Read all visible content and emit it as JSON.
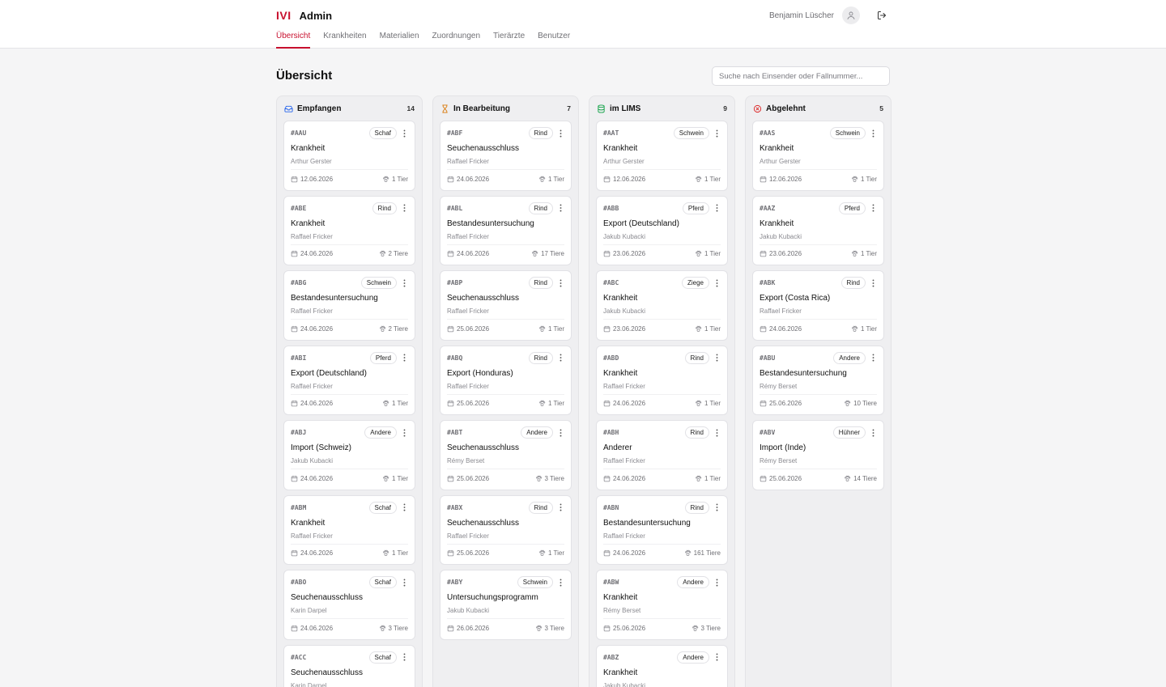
{
  "app": {
    "logo": "IVI",
    "title": "Admin"
  },
  "user": {
    "name": "Benjamin Lüscher"
  },
  "nav": [
    {
      "label": "Übersicht",
      "active": true
    },
    {
      "label": "Krankheiten",
      "active": false
    },
    {
      "label": "Materialien",
      "active": false
    },
    {
      "label": "Zuordnungen",
      "active": false
    },
    {
      "label": "Tierärzte",
      "active": false
    },
    {
      "label": "Benutzer",
      "active": false
    }
  ],
  "page": {
    "title": "Übersicht",
    "search_placeholder": "Suche nach Einsender oder Fallnummer..."
  },
  "colors": {
    "brand": "#c8102e",
    "received": "#2563eb",
    "in_progress": "#d97706",
    "lims": "#16a34a",
    "rejected": "#dc2626"
  },
  "columns": [
    {
      "title": "Empfangen",
      "count": "14",
      "icon": "inbox-icon",
      "cards": [
        {
          "id": "#AAU",
          "species": "Schaf",
          "title": "Krankheit",
          "sender": "Arthur Gerster",
          "date": "12.06.2026",
          "animals": "1 Tier"
        },
        {
          "id": "#ABE",
          "species": "Rind",
          "title": "Krankheit",
          "sender": "Raffael Fricker",
          "date": "24.06.2026",
          "animals": "2 Tiere"
        },
        {
          "id": "#ABG",
          "species": "Schwein",
          "title": "Bestandesuntersuchung",
          "sender": "Raffael Fricker",
          "date": "24.06.2026",
          "animals": "2 Tiere"
        },
        {
          "id": "#ABI",
          "species": "Pferd",
          "title": "Export (Deutschland)",
          "sender": "Raffael Fricker",
          "date": "24.06.2026",
          "animals": "1 Tier"
        },
        {
          "id": "#ABJ",
          "species": "Andere",
          "title": "Import (Schweiz)",
          "sender": "Jakub Kubacki",
          "date": "24.06.2026",
          "animals": "1 Tier"
        },
        {
          "id": "#ABM",
          "species": "Schaf",
          "title": "Krankheit",
          "sender": "Raffael Fricker",
          "date": "24.06.2026",
          "animals": "1 Tier"
        },
        {
          "id": "#ABO",
          "species": "Schaf",
          "title": "Seuchenausschluss",
          "sender": "Karin Darpel",
          "date": "24.06.2026",
          "animals": "3 Tiere"
        },
        {
          "id": "#ACC",
          "species": "Schaf",
          "title": "Seuchenausschluss",
          "sender": "Karin Darpel",
          "date": "",
          "animals": ""
        }
      ]
    },
    {
      "title": "In Bearbeitung",
      "count": "7",
      "icon": "hourglass-icon",
      "cards": [
        {
          "id": "#ABF",
          "species": "Rind",
          "title": "Seuchenausschluss",
          "sender": "Raffael Fricker",
          "date": "24.06.2026",
          "animals": "1 Tier"
        },
        {
          "id": "#ABL",
          "species": "Rind",
          "title": "Bestandesuntersuchung",
          "sender": "Raffael Fricker",
          "date": "24.06.2026",
          "animals": "17 Tiere"
        },
        {
          "id": "#ABP",
          "species": "Rind",
          "title": "Seuchenausschluss",
          "sender": "Raffael Fricker",
          "date": "25.06.2026",
          "animals": "1 Tier"
        },
        {
          "id": "#ABQ",
          "species": "Rind",
          "title": "Export (Honduras)",
          "sender": "Raffael Fricker",
          "date": "25.06.2026",
          "animals": "1 Tier"
        },
        {
          "id": "#ABT",
          "species": "Andere",
          "title": "Seuchenausschluss",
          "sender": "Rémy Berset",
          "date": "25.06.2026",
          "animals": "3 Tiere"
        },
        {
          "id": "#ABX",
          "species": "Rind",
          "title": "Seuchenausschluss",
          "sender": "Raffael Fricker",
          "date": "25.06.2026",
          "animals": "1 Tier"
        },
        {
          "id": "#ABY",
          "species": "Schwein",
          "title": "Untersuchungsprogramm",
          "sender": "Jakub Kubacki",
          "date": "26.06.2026",
          "animals": "3 Tiere"
        }
      ]
    },
    {
      "title": "im LIMS",
      "count": "9",
      "icon": "database-icon",
      "cards": [
        {
          "id": "#AAT",
          "species": "Schwein",
          "title": "Krankheit",
          "sender": "Arthur Gerster",
          "date": "12.06.2026",
          "animals": "1 Tier"
        },
        {
          "id": "#ABB",
          "species": "Pferd",
          "title": "Export (Deutschland)",
          "sender": "Jakub Kubacki",
          "date": "23.06.2026",
          "animals": "1 Tier"
        },
        {
          "id": "#ABC",
          "species": "Ziege",
          "title": "Krankheit",
          "sender": "Jakub Kubacki",
          "date": "23.06.2026",
          "animals": "1 Tier"
        },
        {
          "id": "#ABD",
          "species": "Rind",
          "title": "Krankheit",
          "sender": "Raffael Fricker",
          "date": "24.06.2026",
          "animals": "1 Tier"
        },
        {
          "id": "#ABH",
          "species": "Rind",
          "title": "Anderer",
          "sender": "Raffael Fricker",
          "date": "24.06.2026",
          "animals": "1 Tier"
        },
        {
          "id": "#ABN",
          "species": "Rind",
          "title": "Bestandesuntersuchung",
          "sender": "Raffael Fricker",
          "date": "24.06.2026",
          "animals": "161 Tiere"
        },
        {
          "id": "#ABW",
          "species": "Andere",
          "title": "Krankheit",
          "sender": "Rémy Berset",
          "date": "25.06.2026",
          "animals": "3 Tiere"
        },
        {
          "id": "#ABZ",
          "species": "Andere",
          "title": "Krankheit",
          "sender": "Jakub Kubacki",
          "date": "",
          "animals": ""
        }
      ]
    },
    {
      "title": "Abgelehnt",
      "count": "5",
      "icon": "x-circle-icon",
      "cards": [
        {
          "id": "#AAS",
          "species": "Schwein",
          "title": "Krankheit",
          "sender": "Arthur Gerster",
          "date": "12.06.2026",
          "animals": "1 Tier"
        },
        {
          "id": "#AAZ",
          "species": "Pferd",
          "title": "Krankheit",
          "sender": "Jakub Kubacki",
          "date": "23.06.2026",
          "animals": "1 Tier"
        },
        {
          "id": "#ABK",
          "species": "Rind",
          "title": "Export (Costa Rica)",
          "sender": "Raffael Fricker",
          "date": "24.06.2026",
          "animals": "1 Tier"
        },
        {
          "id": "#ABU",
          "species": "Andere",
          "title": "Bestandesuntersuchung",
          "sender": "Rémy Berset",
          "date": "25.06.2026",
          "animals": "10 Tiere"
        },
        {
          "id": "#ABV",
          "species": "Hühner",
          "title": "Import (Inde)",
          "sender": "Rémy Berset",
          "date": "25.06.2026",
          "animals": "14 Tiere"
        }
      ]
    }
  ]
}
